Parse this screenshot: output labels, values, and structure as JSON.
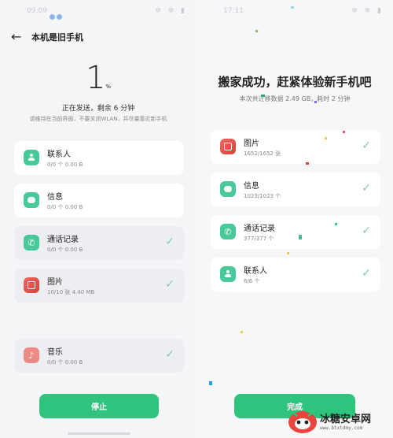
{
  "left": {
    "status": {
      "time": "09:09",
      "right": "✲ ✲ ▮"
    },
    "title": "本机是旧手机",
    "progress": {
      "value": "1",
      "unit": "%"
    },
    "sending_text": "正在发送，剩余 6 分钟",
    "hint_text": "请维持在当前界面，不要关闭WLAN，并尽量靠近新手机",
    "items": [
      {
        "name": "联系人",
        "meta": "0/0 个   0.00 B",
        "icon": "contact-icon",
        "done": false
      },
      {
        "name": "信息",
        "meta": "0/0 个   0.00 B",
        "icon": "message-icon",
        "done": false
      },
      {
        "name": "通话记录",
        "meta": "0/0 个   0.00 B",
        "icon": "phone-icon",
        "done": true
      },
      {
        "name": "图片",
        "meta": "10/10 张   4.40 MB",
        "icon": "photo-icon",
        "done": true
      },
      {
        "name": "音乐",
        "meta": "0/0 个   0.00 B",
        "icon": "music-icon",
        "done": true
      }
    ],
    "stop_label": "停止"
  },
  "right": {
    "status": {
      "time": "17:11",
      "right": "✲ ✲ ▮"
    },
    "title": "搬家成功，赶紧体验新手机吧",
    "subtitle": "本次共迁移数据 2.49 GB，耗时 2 分钟",
    "items": [
      {
        "name": "图片",
        "meta": "1652/1652 张",
        "icon": "photo-icon",
        "done": true
      },
      {
        "name": "信息",
        "meta": "1023/1023 个",
        "icon": "message-icon",
        "done": true
      },
      {
        "name": "通话记录",
        "meta": "377/377 个",
        "icon": "phone-icon",
        "done": true
      },
      {
        "name": "联系人",
        "meta": "6/6 个",
        "icon": "contact-icon",
        "done": true
      }
    ],
    "finish_label": "完成"
  },
  "watermark": {
    "name": "冰糖安卓网",
    "url": "www.btxtdmy.com"
  },
  "colors": {
    "accent": "#2ec47d",
    "icon_green": "#49c99a",
    "icon_red": "#e0524a",
    "check": "#7dcbab"
  }
}
